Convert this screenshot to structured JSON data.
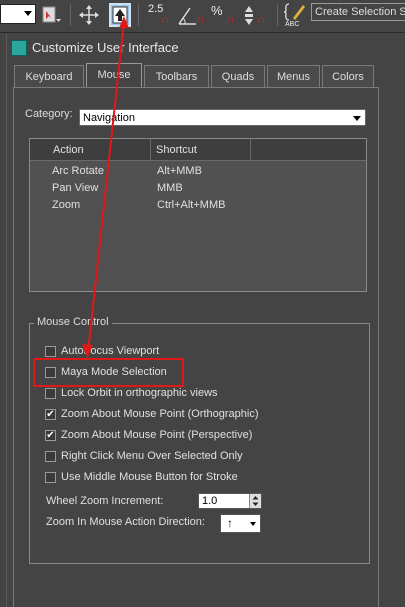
{
  "toolbar": {
    "snap_25_label": "2.5",
    "percent_label": "%",
    "abc_label": "ABC",
    "search_text": "Create Selection Se"
  },
  "dialog": {
    "title": "Customize User Interface",
    "tabs": [
      {
        "label": "Keyboard"
      },
      {
        "label": "Mouse"
      },
      {
        "label": "Toolbars"
      },
      {
        "label": "Quads"
      },
      {
        "label": "Menus"
      },
      {
        "label": "Colors"
      }
    ],
    "active_tab": "Mouse",
    "category_label": "Category:",
    "category_value": "Navigation",
    "list": {
      "headers": [
        "Action",
        "Shortcut"
      ],
      "rows": [
        {
          "action": "Arc Rotate",
          "shortcut": "Alt+MMB"
        },
        {
          "action": "Pan View",
          "shortcut": "MMB"
        },
        {
          "action": "Zoom",
          "shortcut": "Ctrl+Alt+MMB"
        }
      ]
    },
    "mouse_control": {
      "title": "Mouse Control",
      "options": [
        {
          "label": "AutoFocus Viewport",
          "checked": false
        },
        {
          "label": "Maya Mode Selection",
          "checked": false
        },
        {
          "label": "Lock Orbit in orthographic views",
          "checked": false
        },
        {
          "label": "Zoom About Mouse Point (Orthographic)",
          "checked": true
        },
        {
          "label": "Zoom About Mouse Point (Perspective)",
          "checked": true
        },
        {
          "label": "Right Click Menu Over Selected Only",
          "checked": false
        },
        {
          "label": "Use Middle Mouse Button for Stroke",
          "checked": false
        }
      ],
      "wheel_zoom_label": "Wheel Zoom Increment:",
      "wheel_zoom_value": "1.0",
      "zoom_direction_label": "Zoom In Mouse Action Direction:",
      "zoom_direction_value": "↑"
    }
  },
  "colors": {
    "annotation": "#e01818",
    "selected_tool": "#9bc4e8"
  }
}
